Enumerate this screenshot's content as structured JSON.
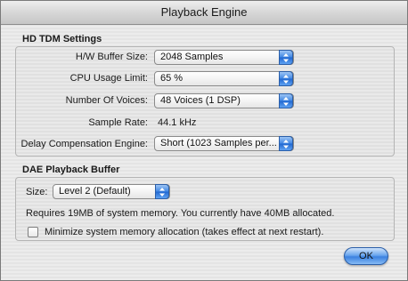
{
  "window": {
    "title": "Playback Engine"
  },
  "hd_tdm": {
    "title": "HD TDM Settings",
    "buffer_size_label": "H/W Buffer Size:",
    "buffer_size_value": "2048 Samples",
    "cpu_limit_label": "CPU Usage Limit:",
    "cpu_limit_value": "65 %",
    "voices_label": "Number Of Voices:",
    "voices_value": "48 Voices (1 DSP)",
    "sample_rate_label": "Sample Rate:",
    "sample_rate_value": "44.1 kHz",
    "delay_comp_label": "Delay Compensation Engine:",
    "delay_comp_value": "Short (1023 Samples per..."
  },
  "dae": {
    "title": "DAE Playback Buffer",
    "size_label": "Size:",
    "size_value": "Level 2 (Default)",
    "memory_info": "Requires 19MB of system memory. You currently have 40MB allocated.",
    "minimize_label": "Minimize system memory allocation (takes effect at next restart).",
    "minimize_checked": false
  },
  "buttons": {
    "ok_label": "OK"
  },
  "colors": {
    "accent": "#3f86e4",
    "window_bg": "#ececec"
  }
}
